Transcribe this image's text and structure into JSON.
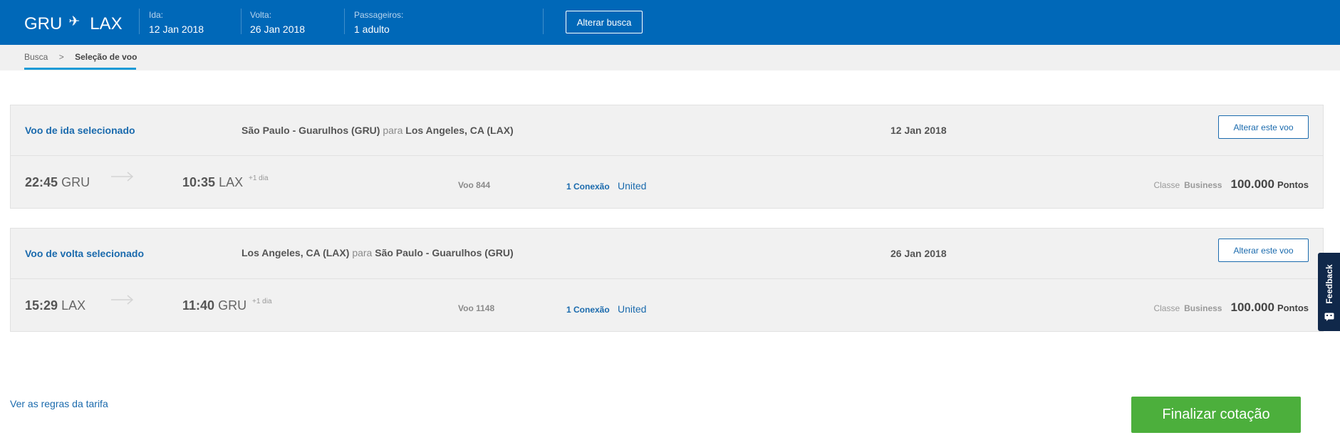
{
  "header": {
    "origin": "GRU",
    "destination": "LAX",
    "ida": {
      "label": "Ida:",
      "value": "12 Jan 2018"
    },
    "volta": {
      "label": "Volta:",
      "value": "26 Jan 2018"
    },
    "passageiros": {
      "label": "Passageiros:",
      "value": "1 adulto"
    },
    "change_search_label": "Alterar busca",
    "background_color": "#0068b8"
  },
  "breadcrumb": {
    "items": [
      "Busca",
      "Seleção de voo"
    ],
    "separator": ">"
  },
  "flights": [
    {
      "title": "Voo de ida selecionado",
      "from": "São Paulo - Guarulhos (GRU)",
      "connector": "para",
      "to": "Los Angeles, CA (LAX)",
      "date": "12 Jan 2018",
      "change_label": "Alterar este voo",
      "departure_time": "22:45",
      "departure_code": "GRU",
      "arrival_time": "10:35",
      "arrival_code": "LAX",
      "day_offset": "+1 dia",
      "flight_number": "Voo 844",
      "connections": "1 Conexão",
      "airline": "United",
      "class_label": "Classe",
      "class_name": "Business",
      "points": "100.000",
      "points_label": "Pontos"
    },
    {
      "title": "Voo de volta selecionado",
      "from": "Los Angeles, CA (LAX)",
      "connector": "para",
      "to": "São Paulo - Guarulhos (GRU)",
      "date": "26 Jan 2018",
      "change_label": "Alterar este voo",
      "departure_time": "15:29",
      "departure_code": "LAX",
      "arrival_time": "11:40",
      "arrival_code": "GRU",
      "day_offset": "+1 dia",
      "flight_number": "Voo 1148",
      "connections": "1 Conexão",
      "airline": "United",
      "class_label": "Classe",
      "class_name": "Business",
      "points": "100.000",
      "points_label": "Pontos"
    }
  ],
  "footer": {
    "fare_rules_link": "Ver as regras da tarifa",
    "finish_label": "Finalizar cotação",
    "finish_color": "#4caf3c"
  },
  "feedback": {
    "label": "Feedback",
    "icon": "chat-icon"
  },
  "icons": {
    "plane": "plane-icon",
    "arrow": "arrow-right-icon"
  }
}
